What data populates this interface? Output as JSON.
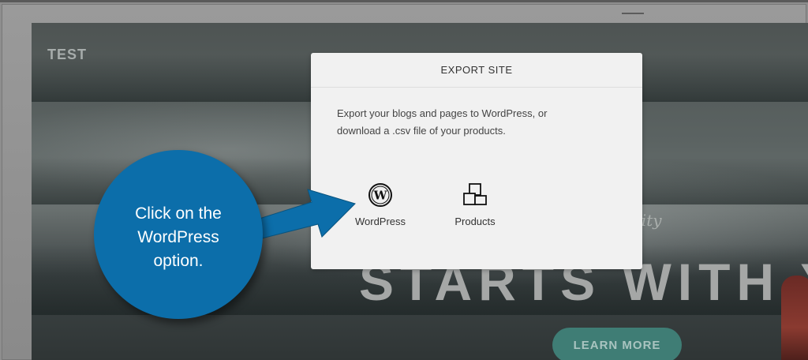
{
  "site": {
    "title": "TEST",
    "tagline": "ility",
    "headline": "STARTS WITH YO",
    "cta_label": "LEARN MORE"
  },
  "modal": {
    "title": "EXPORT SITE",
    "description_line1": "Export your blogs and pages to WordPress, or",
    "description_line2": "download a .csv file of your products.",
    "options": [
      {
        "label": "WordPress",
        "icon": "wordpress-icon"
      },
      {
        "label": "Products",
        "icon": "products-icon"
      }
    ]
  },
  "callout": {
    "line1": "Click on the",
    "line2": "WordPress",
    "line3": "option."
  },
  "colors": {
    "callout": "#0c6eaa",
    "cta": "#3f7d75",
    "modal_bg": "#f1f1f1"
  }
}
